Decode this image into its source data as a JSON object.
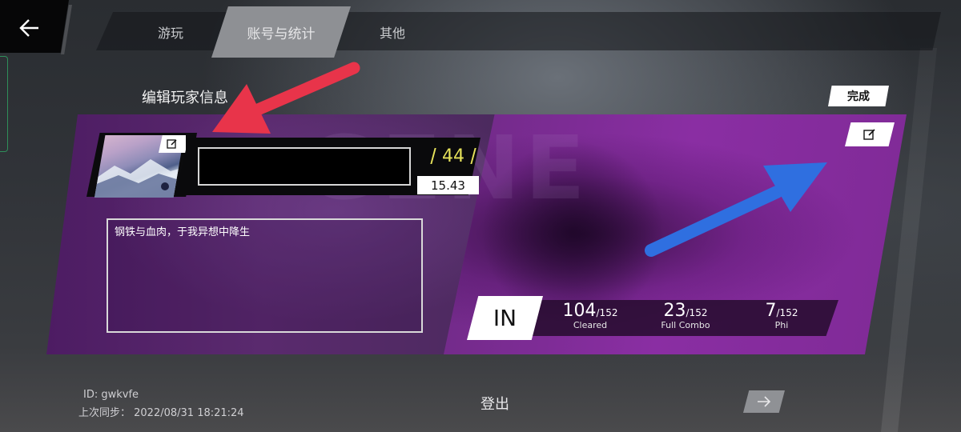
{
  "tabs": [
    {
      "label": "游玩"
    },
    {
      "label": "账号与统计",
      "active": true
    },
    {
      "label": "其他"
    }
  ],
  "edit_title": "编辑玩家信息",
  "done_label": "完成",
  "profile": {
    "level": "44",
    "rks": "15.43",
    "name_value": "",
    "bio": "钢铁与血肉，于我异想中降生"
  },
  "stats": {
    "difficulty": "IN",
    "items": [
      {
        "value": "104",
        "total": "/152",
        "label": "Cleared"
      },
      {
        "value": "23",
        "total": "/152",
        "label": "Full Combo"
      },
      {
        "value": "7",
        "total": "/152",
        "label": "Phi"
      }
    ]
  },
  "footer": {
    "id_text": "ID: gwkvfe",
    "sync_text": "上次同步： 2022/08/31 18:21:24",
    "logout_label": "登出"
  },
  "colors": {
    "accent_level": "#e6e25a",
    "card_purple": "#8a2ea3",
    "arrow_red": "#e8344a",
    "arrow_blue": "#2f6fe0"
  },
  "icons": {
    "back": "arrow-left-icon",
    "edit": "edit-icon",
    "next": "arrow-right-icon"
  }
}
